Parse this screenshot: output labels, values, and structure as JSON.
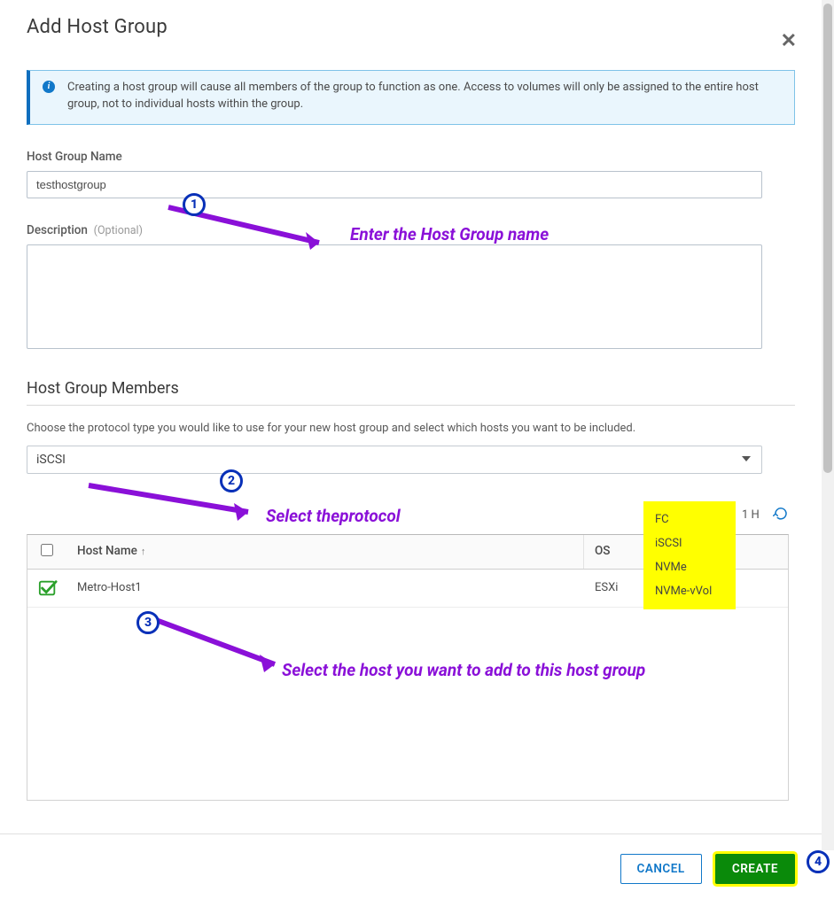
{
  "dialog": {
    "title": "Add Host Group",
    "close_glyph": "✕"
  },
  "info_banner": {
    "text": "Creating a host group will cause all members of the group to function as one. Access to volumes will only be assigned to the entire host group, not to individual hosts within the group."
  },
  "fields": {
    "name_label": "Host Group Name",
    "name_value": "testhostgroup",
    "desc_label": "Description",
    "desc_optional": "(Optional)",
    "desc_value": ""
  },
  "members": {
    "heading": "Host Group Members",
    "helper": "Choose the protocol type you would like to use for your new host group and select which hosts you want to be included.",
    "protocol_selected": "iSCSI",
    "protocol_options": [
      "FC",
      "iSCSI",
      "NVMe",
      "NVMe-vVol"
    ],
    "count_text": "1 H",
    "columns": {
      "name": "Host Name",
      "os": "OS"
    },
    "rows": [
      {
        "name": "Metro-Host1",
        "os": "ESXi",
        "checked": true
      }
    ]
  },
  "footer": {
    "cancel": "CANCEL",
    "create": "CREATE"
  },
  "annotations": {
    "a1": "Enter the Host Group name",
    "a2": "Select theprotocol",
    "a3": "Select the host you want to add to this host group",
    "badges": {
      "b1": "1",
      "b2": "2",
      "b3": "3",
      "b4": "4"
    }
  }
}
